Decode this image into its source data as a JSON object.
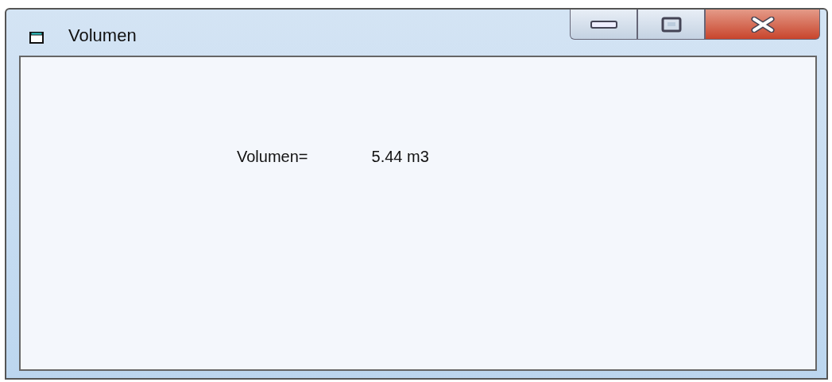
{
  "window": {
    "title": "Volumen"
  },
  "content": {
    "label": "Volumen=",
    "value": "5.44 m3"
  }
}
